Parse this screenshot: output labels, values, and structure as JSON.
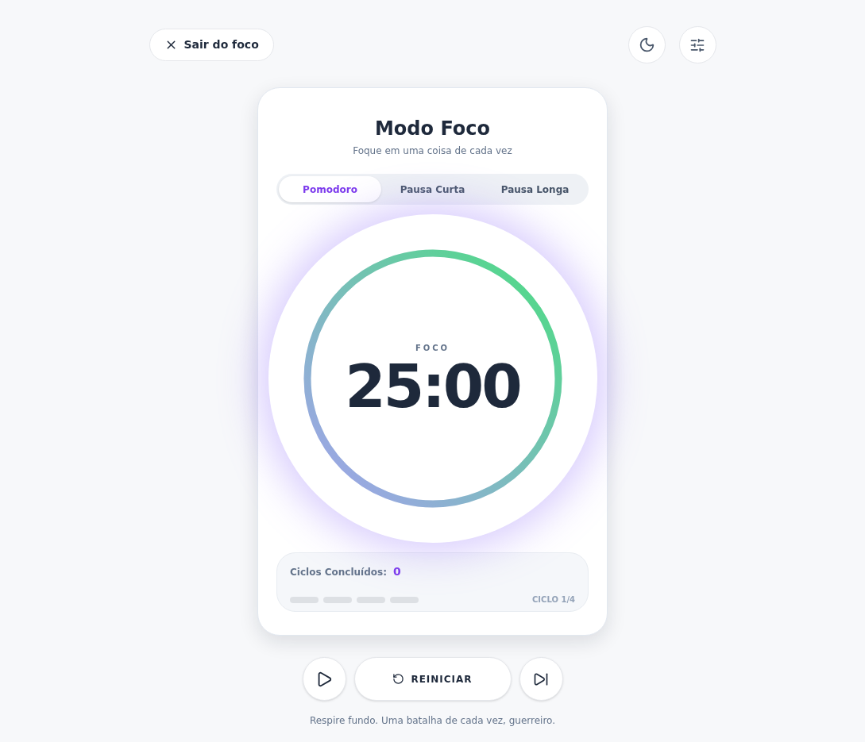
{
  "exit_button": {
    "label": "Sair do foco"
  },
  "card": {
    "title": "Modo Foco",
    "subtitle": "Foque em uma coisa de cada vez"
  },
  "tabs": [
    {
      "label": "Pomodoro",
      "selected": true
    },
    {
      "label": "Pausa Curta",
      "selected": false
    },
    {
      "label": "Pausa Longa",
      "selected": false
    }
  ],
  "timer": {
    "label": "FOCO",
    "time": "25:00",
    "level": 1
  },
  "cycles": {
    "label": "Ciclos Concluídos:",
    "count": "0",
    "indicator": "CICLO 1/4",
    "segments": [
      {
        "done": false
      },
      {
        "done": false
      },
      {
        "done": false
      },
      {
        "done": false
      }
    ]
  },
  "controls": {
    "reset_label": "REINICIAR"
  },
  "footer": "Respire fundo. Uma batalha de cada vez, guerreiro."
}
